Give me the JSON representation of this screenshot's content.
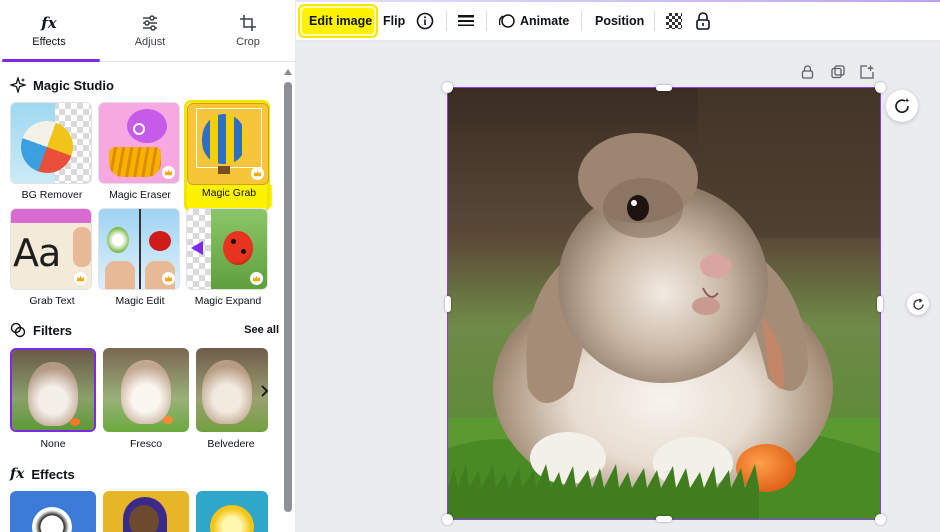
{
  "panel": {
    "tabs": [
      {
        "label": "Effects",
        "icon": "fx-icon",
        "glyph": "fx"
      },
      {
        "label": "Adjust",
        "icon": "sliders-icon"
      },
      {
        "label": "Crop",
        "icon": "crop-icon"
      }
    ],
    "magic_studio": {
      "title": "Magic Studio",
      "tools": [
        {
          "label": "BG Remover"
        },
        {
          "label": "Magic Eraser"
        },
        {
          "label": "Magic Grab"
        },
        {
          "label": "Grab Text",
          "thumb_text": "Aa"
        },
        {
          "label": "Magic Edit"
        },
        {
          "label": "Magic Expand"
        }
      ]
    },
    "filters": {
      "title": "Filters",
      "see_all": "See all",
      "items": [
        {
          "label": "None"
        },
        {
          "label": "Fresco"
        },
        {
          "label": "Belvedere"
        }
      ]
    },
    "effects": {
      "title": "Effects",
      "glyph": "fx"
    }
  },
  "toolbar": {
    "edit_image": "Edit image",
    "flip": "Flip",
    "animate": "Animate",
    "position": "Position"
  },
  "colors": {
    "accent": "#7d2ae8",
    "highlight": "#fff200",
    "canvas_bg": "#ebecf0"
  }
}
